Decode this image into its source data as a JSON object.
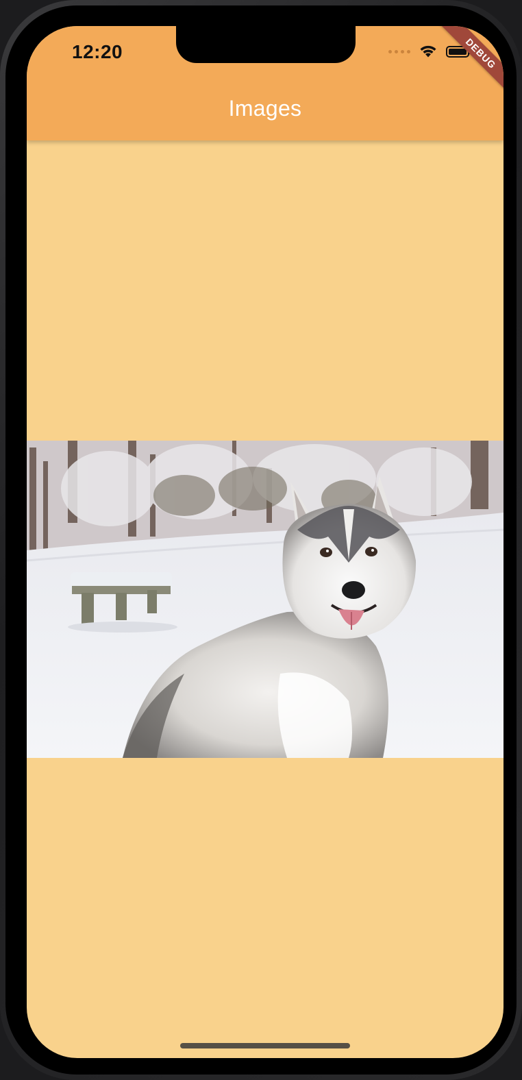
{
  "status_bar": {
    "time": "12:20"
  },
  "app_bar": {
    "title": "Images",
    "background_color": "#f3aa58"
  },
  "body": {
    "background_color": "#f9d28c",
    "image": {
      "subject": "husky-dog-in-snow-park"
    }
  },
  "debug_banner": {
    "label": "DEBUG",
    "color": "#a0483a"
  }
}
